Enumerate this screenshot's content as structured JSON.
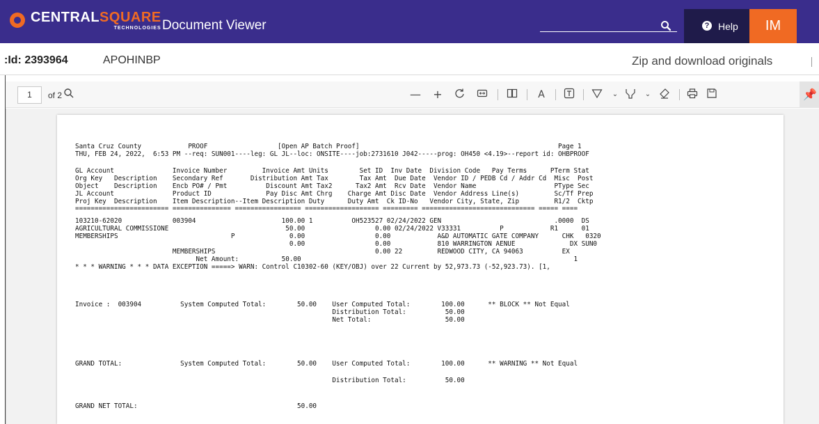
{
  "topbar": {
    "logo_main_part1": "CENTRAL",
    "logo_main_part2": "SQUARE",
    "logo_sub": "TECHNOLOGIES",
    "app_title": "Document Viewer",
    "help_label": "Help",
    "user_initials": "IM",
    "colors": {
      "bar": "#3a2d8c",
      "accent": "#f06a23",
      "help_bg": "#1f1b4a"
    }
  },
  "doc_header": {
    "doc_id": ":Id: 2393964",
    "doc_code": "APOHINBP",
    "zip_link": "Zip and download originals"
  },
  "viewer_toolbar": {
    "page_input_value": "1",
    "page_total": "of 2",
    "icons": [
      "search-icon",
      "zoom-out-icon",
      "zoom-in-icon",
      "rotate-icon",
      "fit-width-icon",
      "page-view-icon",
      "read-aloud-icon",
      "text-icon",
      "draw-icon",
      "highlight-icon",
      "erase-icon",
      "print-icon",
      "save-icon",
      "pin-icon"
    ]
  },
  "document": {
    "header_line1": "Santa Cruz County            PROOF                  [Open AP Batch Proof]                                                   Page 1",
    "header_line2": "THU, FEB 24, 2022,  6:53 PM --req: SUN001----leg: GL JL--loc: ONSITE----job:2731610 J042-----prog: OH450 <4.19>--report id: OHBPROOF",
    "col_headers": [
      "GL Account               Invoice Number         Invoice Amt Units        Set ID  Inv Date  Division Code   Pay Terms      PTerm Stat",
      "Org Key   Description    Secondary Ref       Distribution Amt Tax        Tax Amt  Due Date  Vendor ID / PEDB Cd / Addr Cd  Misc  Post",
      "Object    Description    Encb PO# / Pmt          Discount Amt Tax2      Tax2 Amt  Rcv Date  Vendor Name                    PType Sec",
      "JL Account               Product ID              Pay Disc Amt Chrg    Charge Amt Disc Date  Vendor Address Line(s)         Sc/Tf Prep",
      "Proj Key  Description    Item Description--Item Description Duty      Duty Amt  Ck ID-No   Vendor City, State, Zip         R1/2  Cktp"
    ],
    "separator": "======================== =============== ================= =================== ========= ============================= ===== ====",
    "detail_lines": [
      "103210-62020             003904                      100.00 1          OH523527 02/24/2022 GEN                             .0000  DS",
      "AGRICULTURAL COMMISSIONE                              50.00                  0.00 02/24/2022 V33331          P            R1      01",
      "MEMBERSHIPS                             P              0.00                  0.00            A&D AUTOMATIC GATE COMPANY      CHK   0320",
      "                                                       0.00                  0.00            810 WARRINGTON AENUE              DX SUN0",
      "                         MEMBERSHIPS                                         0.00 22         REDWOOD CITY, CA 94063          EX",
      "                               Net Amount:           50.00                                                                      1"
    ],
    "warning_line": "* * * WARNING * * * DATA EXCEPTION =====> WARN: Control C10302-60 (KEY/OBJ) over 22 Current by 52,973.73 (-52,923.73). [1,",
    "invoice_block": [
      "Invoice :  003904          System Computed Total:        50.00    User Computed Total:        100.00      ** BLOCK ** Not Equal",
      "                                                                  Distribution Total:          50.00",
      "                                                                  Net Total:                   50.00"
    ],
    "grand_total": [
      "GRAND TOTAL:               System Computed Total:        50.00    User Computed Total:        100.00      ** WARNING ** Not Equal",
      "",
      "                                                                  Distribution Total:          50.00"
    ],
    "grand_net_total": "GRAND NET TOTAL:                                         50.00"
  }
}
